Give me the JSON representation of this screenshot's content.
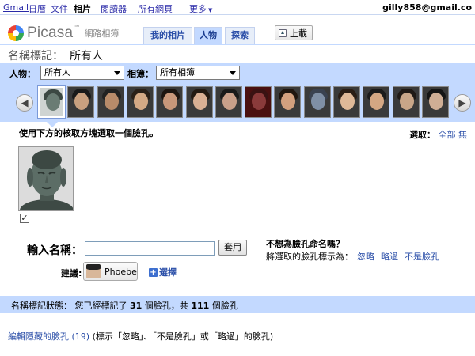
{
  "gbar": {
    "items": [
      "Gmail",
      "日曆",
      "文件",
      "相片",
      "閱讀器",
      "所有網頁",
      "更多"
    ],
    "more_arrow": "▼",
    "user": "gilly858@gmail.co"
  },
  "header": {
    "logo_text": "Picasa",
    "logo_tm": "™",
    "logo_sub": "網路相簿",
    "tabs": [
      "我的相片",
      "人物",
      "探索"
    ],
    "upload_label": "上載"
  },
  "page": {
    "title_label": "名稱標記：",
    "title_value": "所有人"
  },
  "filters": {
    "people_label": "人物：",
    "people_value": "所有人",
    "album_label": "相簿：",
    "album_value": "所有相簿"
  },
  "strip": {
    "prev_icon": "◀",
    "next_icon": "▶",
    "thumb_count": 14
  },
  "instruction": "使用下方的核取方塊選取一個臉孔。",
  "selection": {
    "label": "選取：",
    "all": "全部",
    "none": "無"
  },
  "face_checked": "✓",
  "naming": {
    "label": "輸入名稱：",
    "input_value": "",
    "apply": "套用",
    "suggest_label": "建議:",
    "suggest_name": "Phoebe",
    "choose_plus": "+",
    "choose": "選擇"
  },
  "no_name": {
    "question": "不想為臉孔命名嗎？",
    "mark_label": "將選取的臉孔標示為：",
    "options": [
      "忽略",
      "略過",
      "不是臉孔"
    ]
  },
  "status": {
    "prefix": "名稱標記狀態：  您已經標記了 ",
    "count": "31",
    "middle": " 個臉孔，共 ",
    "total": "111",
    "suffix": " 個臉孔"
  },
  "hidden": {
    "link": "編輯隱藏的臉孔 (19)",
    "note": " (標示「忽略」、「不是臉孔」或「略過」的臉孔)"
  },
  "colors": {
    "panel": "#c3d9ff",
    "link": "#2a4ea8"
  }
}
